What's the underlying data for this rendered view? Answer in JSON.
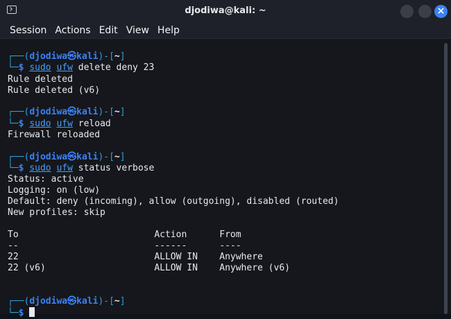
{
  "window": {
    "title": "djodiwa@kali: ~",
    "close_glyph": "×"
  },
  "menu": [
    "Session",
    "Actions",
    "Edit",
    "View",
    "Help"
  ],
  "prompt": {
    "top": "┌──(",
    "user": "djodiwa",
    "at": "㉿",
    "host": "kali",
    "mid": ")-[",
    "dir": "~",
    "end": "]",
    "bottom": "└─",
    "dollar": "$"
  },
  "blocks": [
    {
      "cmd": "sudo",
      "tool": "ufw",
      "args": " delete deny 23",
      "output": [
        "Rule deleted",
        "Rule deleted (v6)"
      ]
    },
    {
      "cmd": "sudo",
      "tool": "ufw",
      "args": " reload",
      "output": [
        "Firewall reloaded"
      ]
    },
    {
      "cmd": "sudo",
      "tool": "ufw",
      "args": " status verbose",
      "output": [
        "Status: active",
        "Logging: on (low)",
        "Default: deny (incoming), allow (outgoing), disabled (routed)",
        "New profiles: skip",
        "",
        "To                         Action      From",
        "--                         ------      ----",
        "22                         ALLOW IN    Anywhere",
        "22 (v6)                    ALLOW IN    Anywhere (v6)"
      ]
    }
  ]
}
